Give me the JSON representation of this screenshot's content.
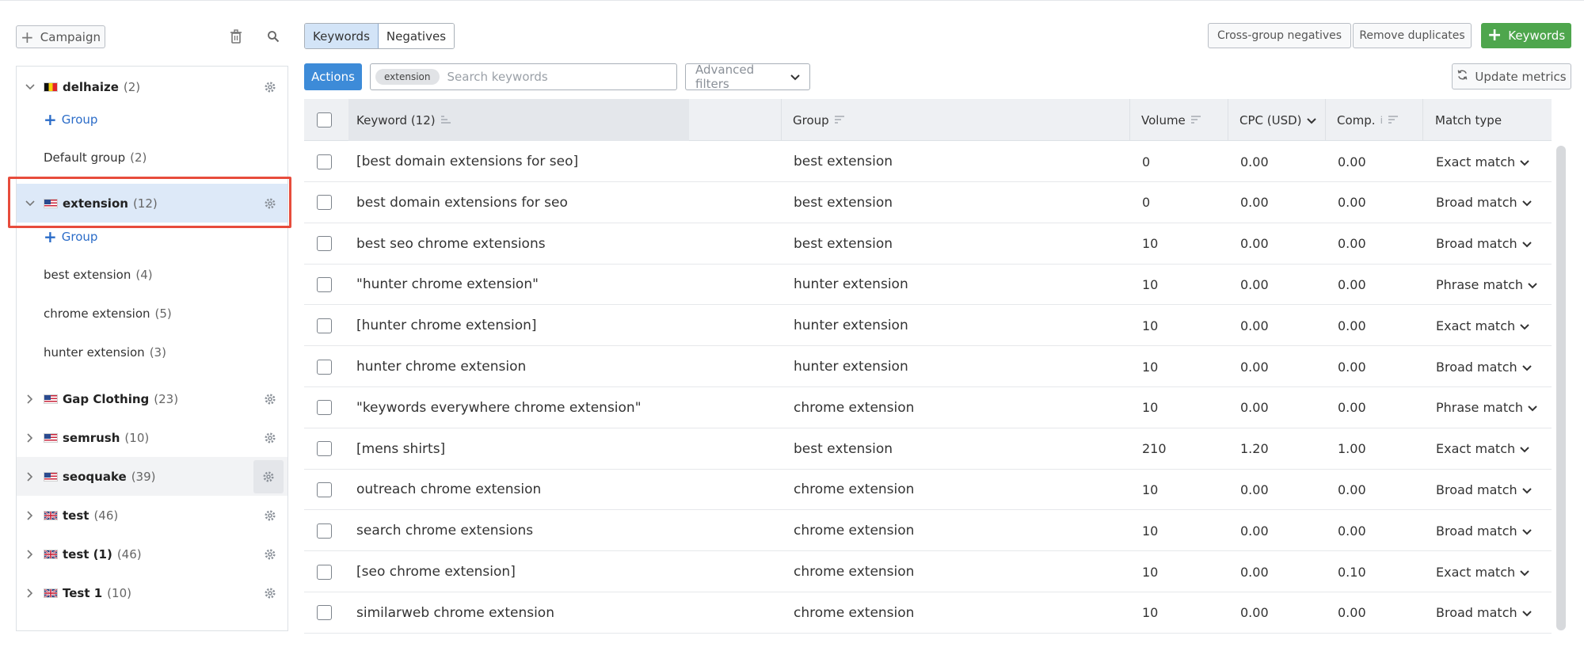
{
  "colors": {
    "accent": "#3d8bd8",
    "green": "#4ea64d",
    "selected_row": "#dde9f8",
    "highlight_border": "#e74c3c"
  },
  "left_toolbar": {
    "campaign_label": "Campaign",
    "trash_icon": "trash-icon",
    "search_icon": "search-icon"
  },
  "sidebar": {
    "group_add_label": "Group",
    "campaigns": [
      {
        "name": "delhaize",
        "count": "(2)",
        "flag": "be"
      },
      {
        "name": "extension",
        "count": "(12)",
        "flag": "us"
      },
      {
        "name": "Gap Clothing",
        "count": "(23)",
        "flag": "us"
      },
      {
        "name": "semrush",
        "count": "(10)",
        "flag": "us"
      },
      {
        "name": "seoquake",
        "count": "(39)",
        "flag": "us"
      },
      {
        "name": "test",
        "count": "(46)",
        "flag": "gb"
      },
      {
        "name": "test (1)",
        "count": "(46)",
        "flag": "gb"
      },
      {
        "name": "Test 1",
        "count": "(10)",
        "flag": "gb"
      }
    ],
    "delhaize_groups": [
      {
        "name": "Default group",
        "count": "(2)"
      }
    ],
    "extension_groups": [
      {
        "name": "best extension",
        "count": "(4)"
      },
      {
        "name": "chrome extension",
        "count": "(5)"
      },
      {
        "name": "hunter extension",
        "count": "(3)"
      }
    ]
  },
  "tabs": {
    "keywords": "Keywords",
    "negatives": "Negatives"
  },
  "top_actions": {
    "cross_group": "Cross-group negatives",
    "remove_dupes": "Remove duplicates",
    "add_keywords": "Keywords"
  },
  "filter_bar": {
    "actions": "Actions",
    "chip": "extension",
    "search_placeholder": "Search keywords",
    "advanced": "Advanced filters",
    "update_metrics": "Update metrics"
  },
  "table": {
    "headers": {
      "keyword": "Keyword (12)",
      "group": "Group",
      "volume": "Volume",
      "cpc": "CPC (USD)",
      "comp": "Comp.",
      "match": "Match type"
    },
    "rows": [
      {
        "keyword": "[best domain extensions for seo]",
        "group": "best extension",
        "volume": "0",
        "cpc": "0.00",
        "comp": "0.00",
        "match": "Exact match"
      },
      {
        "keyword": "best domain extensions for seo",
        "group": "best extension",
        "volume": "0",
        "cpc": "0.00",
        "comp": "0.00",
        "match": "Broad match"
      },
      {
        "keyword": "best seo chrome extensions",
        "group": "best extension",
        "volume": "10",
        "cpc": "0.00",
        "comp": "0.00",
        "match": "Broad match"
      },
      {
        "keyword": "\"hunter chrome extension\"",
        "group": "hunter extension",
        "volume": "10",
        "cpc": "0.00",
        "comp": "0.00",
        "match": "Phrase match"
      },
      {
        "keyword": "[hunter chrome extension]",
        "group": "hunter extension",
        "volume": "10",
        "cpc": "0.00",
        "comp": "0.00",
        "match": "Exact match"
      },
      {
        "keyword": "hunter chrome extension",
        "group": "hunter extension",
        "volume": "10",
        "cpc": "0.00",
        "comp": "0.00",
        "match": "Broad match"
      },
      {
        "keyword": "\"keywords everywhere chrome extension\"",
        "group": "chrome extension",
        "volume": "10",
        "cpc": "0.00",
        "comp": "0.00",
        "match": "Phrase match"
      },
      {
        "keyword": "[mens shirts]",
        "group": "best extension",
        "volume": "210",
        "cpc": "1.20",
        "comp": "1.00",
        "match": "Exact match"
      },
      {
        "keyword": "outreach chrome extension",
        "group": "chrome extension",
        "volume": "10",
        "cpc": "0.00",
        "comp": "0.00",
        "match": "Broad match"
      },
      {
        "keyword": "search chrome extensions",
        "group": "chrome extension",
        "volume": "10",
        "cpc": "0.00",
        "comp": "0.00",
        "match": "Broad match"
      },
      {
        "keyword": "[seo chrome extension]",
        "group": "chrome extension",
        "volume": "10",
        "cpc": "0.00",
        "comp": "0.10",
        "match": "Exact match"
      },
      {
        "keyword": "similarweb chrome extension",
        "group": "chrome extension",
        "volume": "10",
        "cpc": "0.00",
        "comp": "0.00",
        "match": "Broad match"
      }
    ]
  }
}
